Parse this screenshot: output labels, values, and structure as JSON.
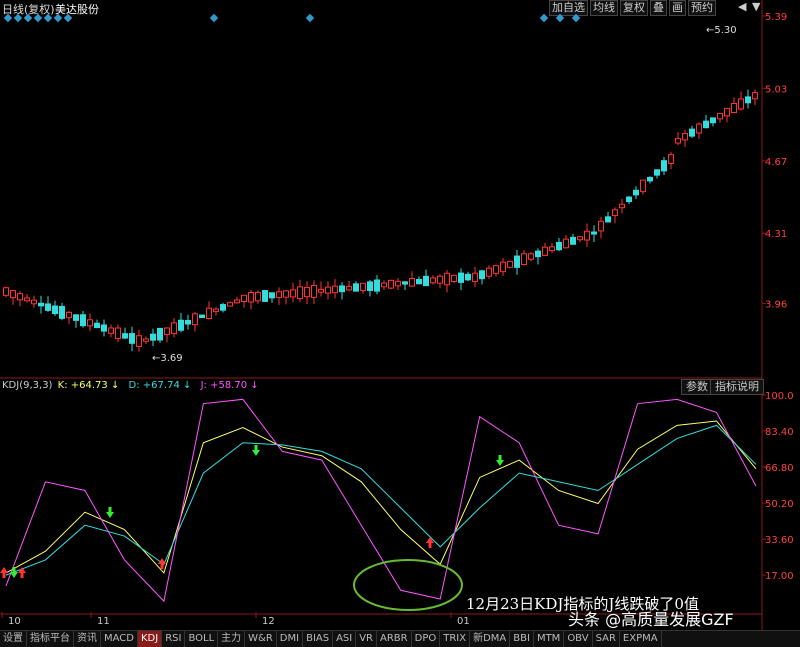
{
  "header": {
    "title": "日线(复权)",
    "stock_name": "美达股份",
    "buttons": [
      "加自选",
      "均线",
      "复权",
      "叠",
      "画",
      "预约"
    ],
    "controls": [
      "◀",
      "▼"
    ]
  },
  "chart_data": [
    {
      "type": "candlestick",
      "title": "日线(复权)",
      "y_ticks": [
        "5.39",
        "5.03",
        "4.67",
        "4.31",
        "3.96"
      ],
      "annotations": [
        "5.30",
        "3.69"
      ],
      "ylim": [
        3.6,
        5.4
      ]
    },
    {
      "type": "line",
      "title": "KDJ(9,3,3)",
      "series": [
        {
          "name": "K",
          "label": "K: +64.73",
          "color": "#ffff66",
          "values": [
            18,
            28,
            46,
            38,
            18,
            78,
            85,
            76,
            72,
            60,
            38,
            22,
            62,
            70,
            56,
            50,
            75,
            86,
            88,
            66
          ]
        },
        {
          "name": "D",
          "label": "D: +67.74",
          "color": "#33dddd",
          "values": [
            17,
            24,
            40,
            35,
            22,
            64,
            78,
            77,
            74,
            66,
            48,
            30,
            48,
            64,
            60,
            56,
            68,
            80,
            86,
            68
          ]
        },
        {
          "name": "J",
          "label": "J: +58.70",
          "color": "#ff55ff",
          "values": [
            12,
            60,
            56,
            24,
            5,
            96,
            98,
            74,
            70,
            40,
            10,
            6,
            90,
            78,
            40,
            36,
            96,
            98,
            92,
            58
          ]
        }
      ],
      "y_ticks": [
        "100.0",
        "83.40",
        "66.80",
        "50.20",
        "33.60",
        "17.00"
      ],
      "x_ticks": [
        "10",
        "11",
        "12",
        "01"
      ],
      "ylim": [
        0,
        100
      ]
    }
  ],
  "kdj_header": {
    "name": "KDJ(9,3,3)",
    "k": "K: +64.73",
    "d": "D: +67.74",
    "j": "J: +58.70"
  },
  "indicator_buttons": [
    "参数",
    "指标说明"
  ],
  "annotation": "12月23日KDJ指标的J线跌破了0值",
  "watermark": "头条 @高质量发展GZF",
  "tabs": [
    "设置",
    "指标平台",
    "资讯",
    "MACD",
    "KDJ",
    "RSI",
    "BOLL",
    "主力",
    "W&R",
    "DMI",
    "BIAS",
    "ASI",
    "VR",
    "ARBR",
    "DPO",
    "TRIX",
    "新DMA",
    "BBI",
    "MTM",
    "OBV",
    "SAR",
    "EXPMA"
  ],
  "active_tab": "KDJ",
  "colors": {
    "up": "#ff3333",
    "down": "#33dddd",
    "k": "#ffff66",
    "d": "#33dddd",
    "j": "#ff55ff",
    "marker": "#3399cc",
    "circle": "#66bb33"
  }
}
